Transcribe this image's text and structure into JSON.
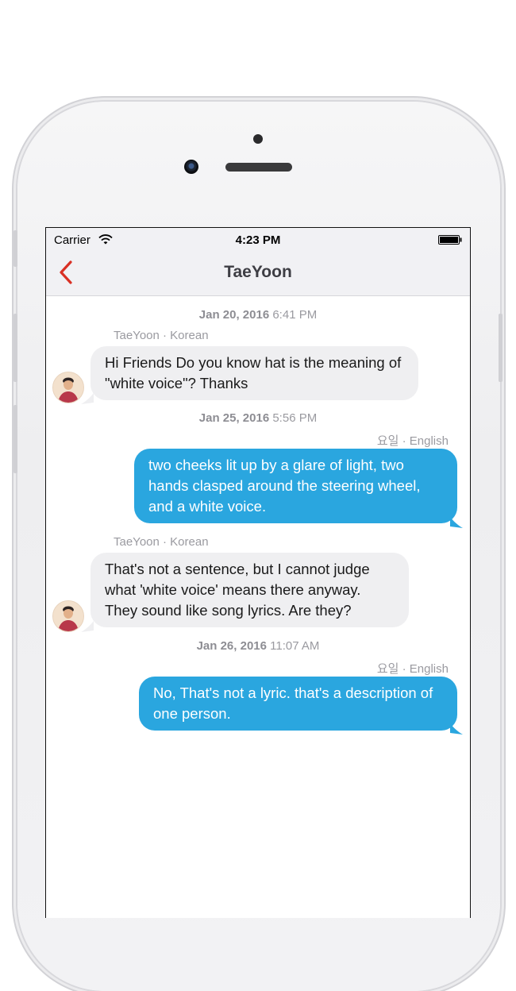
{
  "status_bar": {
    "carrier": "Carrier",
    "time": "4:23 PM"
  },
  "nav": {
    "title": "TaeYoon"
  },
  "colors": {
    "accent": "#d93024",
    "outgoing_bubble": "#2aa6df",
    "incoming_bubble": "#efeff1"
  },
  "conversation": {
    "date_1": {
      "date": "Jan 20, 2016",
      "time": "6:41 PM"
    },
    "msg_1": {
      "sender": "TaeYoon · Korean",
      "text": "Hi Friends Do you know hat is the meaning of \"white voice\"? Thanks"
    },
    "date_2": {
      "date": "Jan 25, 2016",
      "time": "5:56 PM"
    },
    "msg_2": {
      "sender": "요일 · English",
      "text": "two cheeks lit up by a glare of light, two hands clasped around the steering wheel, and a white voice."
    },
    "msg_3": {
      "sender": "TaeYoon · Korean",
      "text": "That's not a sentence, but I cannot judge what 'white voice' means there anyway. They sound like song lyrics. Are they?"
    },
    "date_3": {
      "date": "Jan 26, 2016",
      "time": "11:07 AM"
    },
    "msg_4": {
      "sender": "요일 · English",
      "text": "No, That's not a lyric. that's a description of one person."
    }
  }
}
